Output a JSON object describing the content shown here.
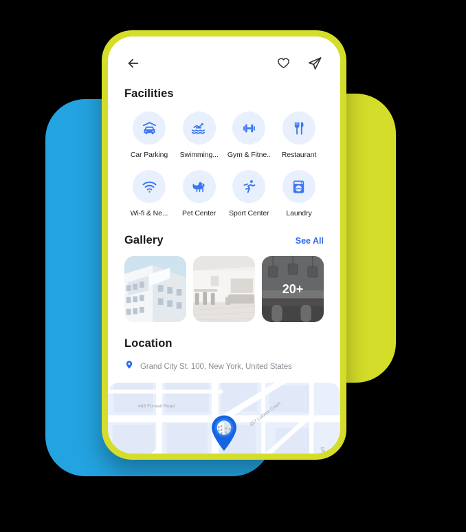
{
  "theme": {
    "yellow": "#D4DE2A",
    "blue": "#23A3E0",
    "accent_blue": "#2F6BF2",
    "icon_bg": "#E8F0FE",
    "text_dark": "#16181d",
    "text_muted": "#8b8f96"
  },
  "topbar": {
    "back_icon": "arrow-left-icon",
    "favorite_icon": "heart-icon",
    "share_icon": "send-icon"
  },
  "facilities": {
    "title": "Facilities",
    "items": [
      {
        "label": "Car Parking",
        "icon": "car-parking-icon"
      },
      {
        "label": "Swimming...",
        "icon": "swimming-icon"
      },
      {
        "label": "Gym & Fitne..",
        "icon": "dumbbell-icon"
      },
      {
        "label": "Restaurant",
        "icon": "restaurant-icon"
      },
      {
        "label": "Wi-fi & Ne...",
        "icon": "wifi-icon"
      },
      {
        "label": "Pet Center",
        "icon": "pet-icon"
      },
      {
        "label": "Sport Center",
        "icon": "running-icon"
      },
      {
        "label": "Laundry",
        "icon": "laundry-icon"
      }
    ]
  },
  "gallery": {
    "title": "Gallery",
    "see_all_label": "See All",
    "items": [
      {
        "alt": "building-exterior-photo",
        "overlay": ""
      },
      {
        "alt": "living-room-photo",
        "overlay": ""
      },
      {
        "alt": "kitchen-photo",
        "overlay": "20+"
      }
    ]
  },
  "location": {
    "title": "Location",
    "pin_icon": "map-pin-icon",
    "address": "Grand City St. 100, New York, United States",
    "map": {
      "streets": [
        "488 Forwell Road",
        "657 Lukken Court",
        "Elka Trail"
      ],
      "marker_icon": "property-marker-icon"
    }
  }
}
